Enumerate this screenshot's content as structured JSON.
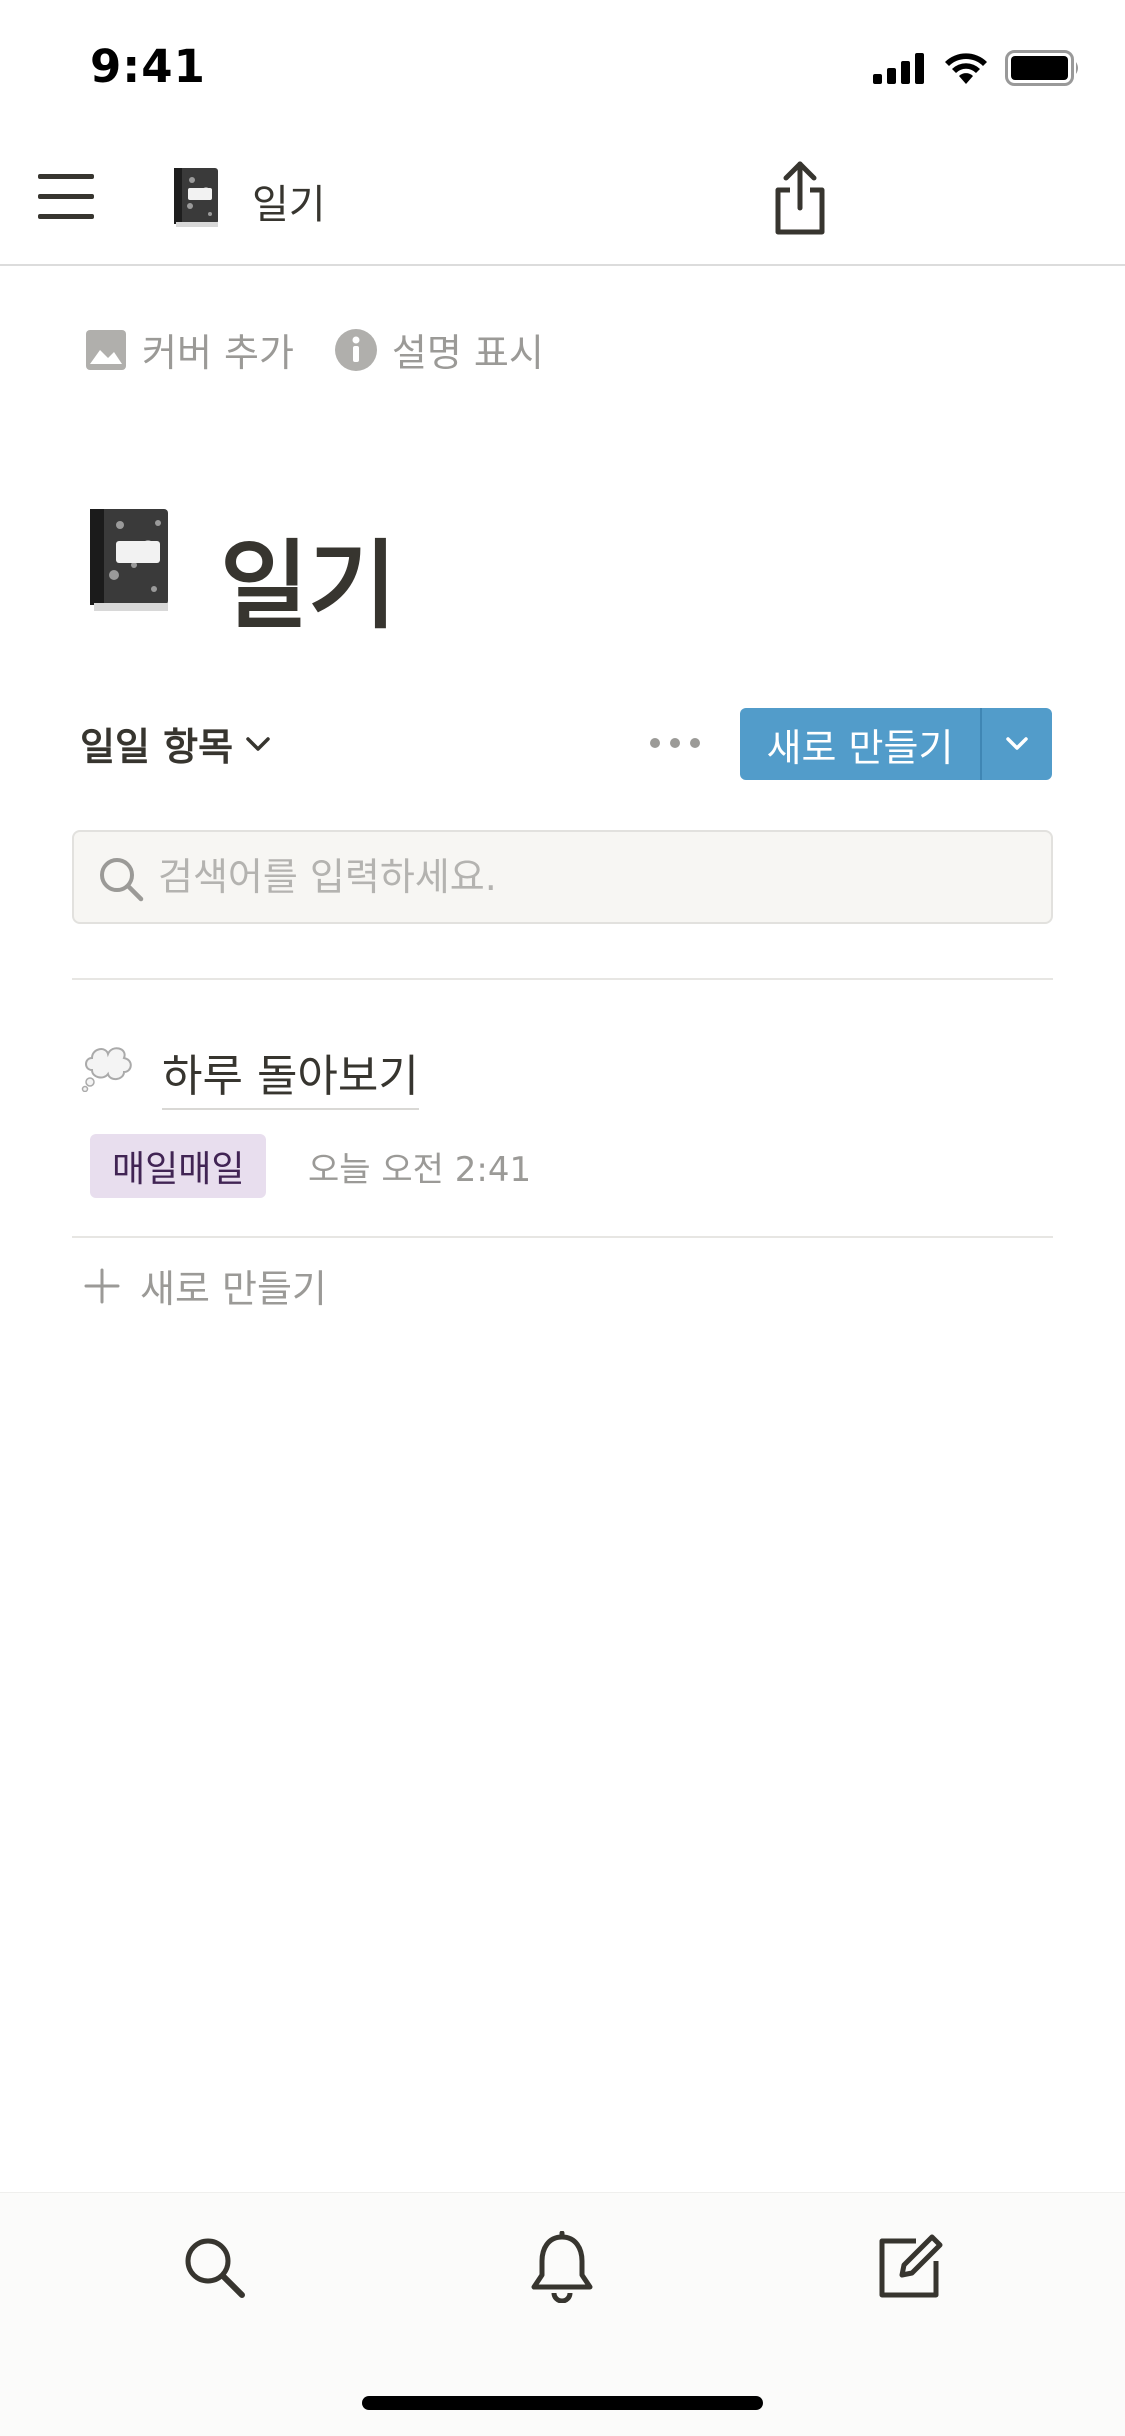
{
  "status_bar": {
    "time": "9:41"
  },
  "nav": {
    "title": "일기"
  },
  "page_actions": {
    "add_cover": "커버 추가",
    "show_description": "설명 표시"
  },
  "page": {
    "title": "일기"
  },
  "view": {
    "name": "일일 항목",
    "new_button": "새로 만들기"
  },
  "search": {
    "placeholder": "검색어를 입력하세요."
  },
  "entries": [
    {
      "title": "하루 돌아보기",
      "tag": "매일매일",
      "time": "오늘 오전 2:41",
      "tag_color": "#e8deee"
    }
  ],
  "add_new_label": "새로 만들기",
  "colors": {
    "accent": "#529cca",
    "text": "#37352f",
    "muted": "#9b9a97"
  },
  "tabs": [
    {
      "icon": "search-icon"
    },
    {
      "icon": "bell-icon"
    },
    {
      "icon": "compose-icon"
    }
  ]
}
